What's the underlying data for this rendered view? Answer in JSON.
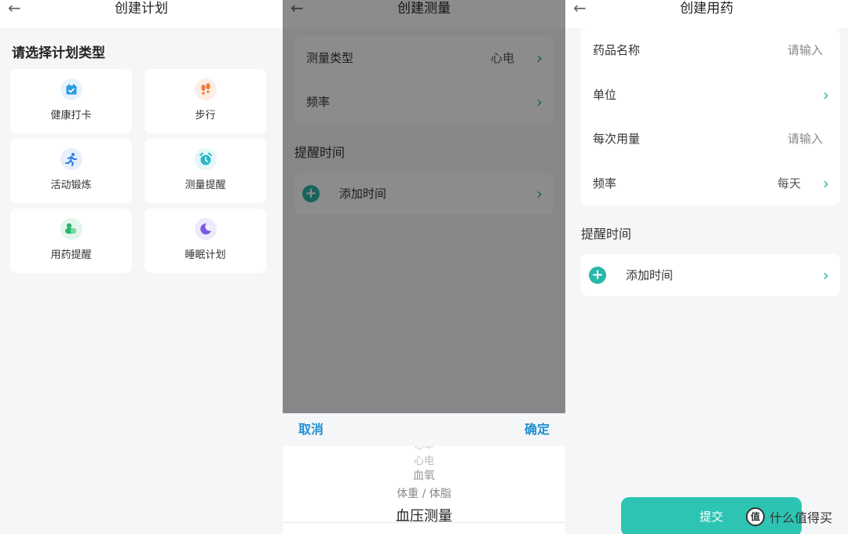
{
  "create_plan": {
    "title": "创建计划",
    "section_title": "请选择计划类型",
    "cards": [
      {
        "label": "健康打卡",
        "icon": "calendar-check-icon",
        "color": "#2f9be3",
        "bg": "#e6f3fc"
      },
      {
        "label": "步行",
        "icon": "footprints-icon",
        "color": "#f07a3c",
        "bg": "#fdeee5"
      },
      {
        "label": "活动锻炼",
        "icon": "running-person-icon",
        "color": "#2f7de3",
        "bg": "#e6effc"
      },
      {
        "label": "测量提醒",
        "icon": "alarm-clock-icon",
        "color": "#2ab7c9",
        "bg": "#e5f7f8"
      },
      {
        "label": "用药提醒",
        "icon": "pill-icon",
        "color": "#2bb673",
        "bg": "#e4f6ec"
      },
      {
        "label": "睡眠计划",
        "icon": "moon-sleep-icon",
        "color": "#7a5ae0",
        "bg": "#eee9fb"
      }
    ]
  },
  "create_measure": {
    "title": "创建测量",
    "rows": [
      {
        "label": "测量类型",
        "value": "心电"
      },
      {
        "label": "频率",
        "value": ""
      }
    ],
    "reminder_title": "提醒时间",
    "add_time": "添加时间",
    "sheet": {
      "cancel": "取消",
      "confirm": "确定",
      "options": [
        "心率",
        "心电",
        "血氧",
        "体重 / 体脂",
        "血压测量"
      ]
    }
  },
  "create_medication": {
    "title": "创建用药",
    "rows": [
      {
        "label": "药品名称",
        "value": "请输入"
      },
      {
        "label": "单位",
        "value": ""
      },
      {
        "label": "每次用量",
        "value": "请输入"
      },
      {
        "label": "频率",
        "value": "每天"
      }
    ],
    "reminder_title": "提醒时间",
    "add_time": "添加时间",
    "submit": "提交"
  },
  "watermark": {
    "logo": "值",
    "text": "什么值得买"
  },
  "colors": {
    "accent": "#2ab7a9",
    "link": "#1e8fd0"
  }
}
